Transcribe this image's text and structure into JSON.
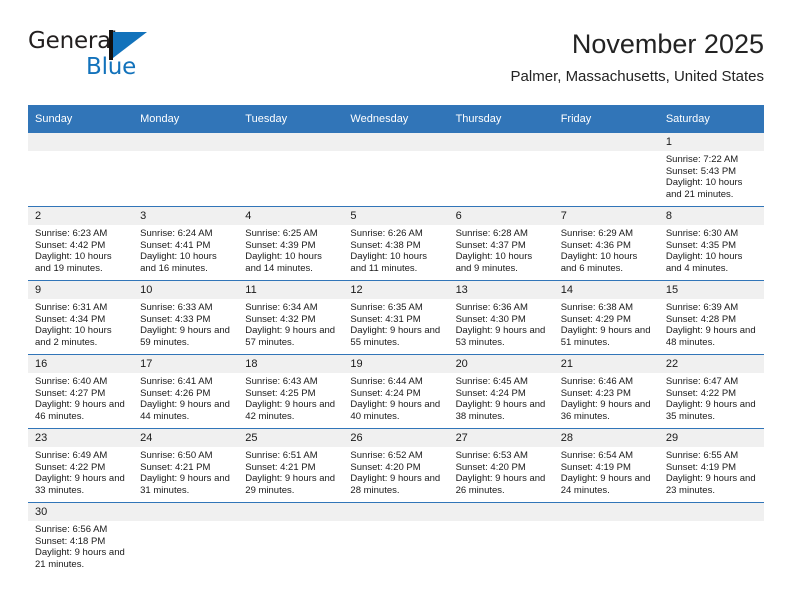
{
  "logo": {
    "name": "general-blue-logo",
    "line1": "General",
    "line2": "Blue",
    "accent_color": "#1272bb"
  },
  "header": {
    "title": "November 2025",
    "subtitle": "Palmer, Massachusetts, United States"
  },
  "theme": {
    "header_blue": "#3175b8",
    "day_band_gray": "#f0f0f0",
    "text_color": "#1a1a1a"
  },
  "weekdays": [
    "Sunday",
    "Monday",
    "Tuesday",
    "Wednesday",
    "Thursday",
    "Friday",
    "Saturday"
  ],
  "labels": {
    "sunrise": "Sunrise:",
    "sunset": "Sunset:",
    "daylight": "Daylight:"
  },
  "weeks": [
    [
      {
        "day": ""
      },
      {
        "day": ""
      },
      {
        "day": ""
      },
      {
        "day": ""
      },
      {
        "day": ""
      },
      {
        "day": ""
      },
      {
        "day": "1",
        "sunrise": "Sunrise: 7:22 AM",
        "sunset": "Sunset: 5:43 PM",
        "daylight": "Daylight: 10 hours and 21 minutes."
      }
    ],
    [
      {
        "day": "2",
        "sunrise": "Sunrise: 6:23 AM",
        "sunset": "Sunset: 4:42 PM",
        "daylight": "Daylight: 10 hours and 19 minutes."
      },
      {
        "day": "3",
        "sunrise": "Sunrise: 6:24 AM",
        "sunset": "Sunset: 4:41 PM",
        "daylight": "Daylight: 10 hours and 16 minutes."
      },
      {
        "day": "4",
        "sunrise": "Sunrise: 6:25 AM",
        "sunset": "Sunset: 4:39 PM",
        "daylight": "Daylight: 10 hours and 14 minutes."
      },
      {
        "day": "5",
        "sunrise": "Sunrise: 6:26 AM",
        "sunset": "Sunset: 4:38 PM",
        "daylight": "Daylight: 10 hours and 11 minutes."
      },
      {
        "day": "6",
        "sunrise": "Sunrise: 6:28 AM",
        "sunset": "Sunset: 4:37 PM",
        "daylight": "Daylight: 10 hours and 9 minutes."
      },
      {
        "day": "7",
        "sunrise": "Sunrise: 6:29 AM",
        "sunset": "Sunset: 4:36 PM",
        "daylight": "Daylight: 10 hours and 6 minutes."
      },
      {
        "day": "8",
        "sunrise": "Sunrise: 6:30 AM",
        "sunset": "Sunset: 4:35 PM",
        "daylight": "Daylight: 10 hours and 4 minutes."
      }
    ],
    [
      {
        "day": "9",
        "sunrise": "Sunrise: 6:31 AM",
        "sunset": "Sunset: 4:34 PM",
        "daylight": "Daylight: 10 hours and 2 minutes."
      },
      {
        "day": "10",
        "sunrise": "Sunrise: 6:33 AM",
        "sunset": "Sunset: 4:33 PM",
        "daylight": "Daylight: 9 hours and 59 minutes."
      },
      {
        "day": "11",
        "sunrise": "Sunrise: 6:34 AM",
        "sunset": "Sunset: 4:32 PM",
        "daylight": "Daylight: 9 hours and 57 minutes."
      },
      {
        "day": "12",
        "sunrise": "Sunrise: 6:35 AM",
        "sunset": "Sunset: 4:31 PM",
        "daylight": "Daylight: 9 hours and 55 minutes."
      },
      {
        "day": "13",
        "sunrise": "Sunrise: 6:36 AM",
        "sunset": "Sunset: 4:30 PM",
        "daylight": "Daylight: 9 hours and 53 minutes."
      },
      {
        "day": "14",
        "sunrise": "Sunrise: 6:38 AM",
        "sunset": "Sunset: 4:29 PM",
        "daylight": "Daylight: 9 hours and 51 minutes."
      },
      {
        "day": "15",
        "sunrise": "Sunrise: 6:39 AM",
        "sunset": "Sunset: 4:28 PM",
        "daylight": "Daylight: 9 hours and 48 minutes."
      }
    ],
    [
      {
        "day": "16",
        "sunrise": "Sunrise: 6:40 AM",
        "sunset": "Sunset: 4:27 PM",
        "daylight": "Daylight: 9 hours and 46 minutes."
      },
      {
        "day": "17",
        "sunrise": "Sunrise: 6:41 AM",
        "sunset": "Sunset: 4:26 PM",
        "daylight": "Daylight: 9 hours and 44 minutes."
      },
      {
        "day": "18",
        "sunrise": "Sunrise: 6:43 AM",
        "sunset": "Sunset: 4:25 PM",
        "daylight": "Daylight: 9 hours and 42 minutes."
      },
      {
        "day": "19",
        "sunrise": "Sunrise: 6:44 AM",
        "sunset": "Sunset: 4:24 PM",
        "daylight": "Daylight: 9 hours and 40 minutes."
      },
      {
        "day": "20",
        "sunrise": "Sunrise: 6:45 AM",
        "sunset": "Sunset: 4:24 PM",
        "daylight": "Daylight: 9 hours and 38 minutes."
      },
      {
        "day": "21",
        "sunrise": "Sunrise: 6:46 AM",
        "sunset": "Sunset: 4:23 PM",
        "daylight": "Daylight: 9 hours and 36 minutes."
      },
      {
        "day": "22",
        "sunrise": "Sunrise: 6:47 AM",
        "sunset": "Sunset: 4:22 PM",
        "daylight": "Daylight: 9 hours and 35 minutes."
      }
    ],
    [
      {
        "day": "23",
        "sunrise": "Sunrise: 6:49 AM",
        "sunset": "Sunset: 4:22 PM",
        "daylight": "Daylight: 9 hours and 33 minutes."
      },
      {
        "day": "24",
        "sunrise": "Sunrise: 6:50 AM",
        "sunset": "Sunset: 4:21 PM",
        "daylight": "Daylight: 9 hours and 31 minutes."
      },
      {
        "day": "25",
        "sunrise": "Sunrise: 6:51 AM",
        "sunset": "Sunset: 4:21 PM",
        "daylight": "Daylight: 9 hours and 29 minutes."
      },
      {
        "day": "26",
        "sunrise": "Sunrise: 6:52 AM",
        "sunset": "Sunset: 4:20 PM",
        "daylight": "Daylight: 9 hours and 28 minutes."
      },
      {
        "day": "27",
        "sunrise": "Sunrise: 6:53 AM",
        "sunset": "Sunset: 4:20 PM",
        "daylight": "Daylight: 9 hours and 26 minutes."
      },
      {
        "day": "28",
        "sunrise": "Sunrise: 6:54 AM",
        "sunset": "Sunset: 4:19 PM",
        "daylight": "Daylight: 9 hours and 24 minutes."
      },
      {
        "day": "29",
        "sunrise": "Sunrise: 6:55 AM",
        "sunset": "Sunset: 4:19 PM",
        "daylight": "Daylight: 9 hours and 23 minutes."
      }
    ],
    [
      {
        "day": "30",
        "sunrise": "Sunrise: 6:56 AM",
        "sunset": "Sunset: 4:18 PM",
        "daylight": "Daylight: 9 hours and 21 minutes."
      },
      {
        "day": ""
      },
      {
        "day": ""
      },
      {
        "day": ""
      },
      {
        "day": ""
      },
      {
        "day": ""
      },
      {
        "day": ""
      }
    ]
  ]
}
